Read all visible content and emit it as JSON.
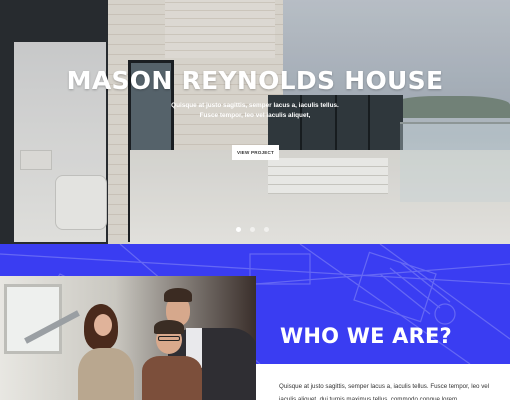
{
  "hero": {
    "title": "MASON REYNOLDS HOUSE",
    "subtitle_line1": "Quisque at justo sagittis, semper lacus a, iaculis tellus.",
    "subtitle_line2": "Fusce tempor, leo vel iaculis aliquet,",
    "button_label": "VIEW PROJECT",
    "slider_dots": 3,
    "active_dot": 1
  },
  "about": {
    "heading": "WHO WE ARE?",
    "text": "Quisque at justo sagittis, semper lacus a, iaculis tellus. Fusce tempor, leo vel iaculis aliquet, dui turpis maximus tellus, commodo congue lorem"
  },
  "colors": {
    "accent_blue": "#3a3df2",
    "white": "#ffffff",
    "text_dark": "#333333"
  }
}
